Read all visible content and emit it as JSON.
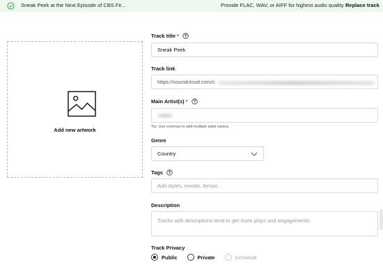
{
  "banner": {
    "file_name": "Sneak Peek at the Next Episode of CBS Fir...",
    "message": "Provide FLAC, WAV, or AIFF for highest audio quality.",
    "replace_label": "Replace track",
    "status_icon": "check-circle-icon",
    "accent_color": "#21a036"
  },
  "artwork": {
    "label": "Add new artwork",
    "icon": "image-icon"
  },
  "form": {
    "title": {
      "label": "Track title",
      "required_mark": "*",
      "value": "Sneak Peek"
    },
    "link": {
      "label": "Track link",
      "value": "https://soundcloud.com/c"
    },
    "artist": {
      "label": "Main Artist(s)",
      "required_mark": "*",
      "tip": "Tip: Use commas to add multiple artist names."
    },
    "genre": {
      "label": "Genre",
      "value": "Country"
    },
    "tags": {
      "label": "Tags",
      "placeholder": "Add styles, moods, tempo."
    },
    "description": {
      "label": "Description",
      "placeholder": "Tracks with descriptions tend to get more plays and engagements."
    },
    "privacy": {
      "label": "Track Privacy",
      "options": [
        {
          "label": "Public",
          "selected": true
        },
        {
          "label": "Private",
          "selected": false
        },
        {
          "label": "Schedule",
          "selected": false,
          "disabled": true
        }
      ]
    }
  }
}
